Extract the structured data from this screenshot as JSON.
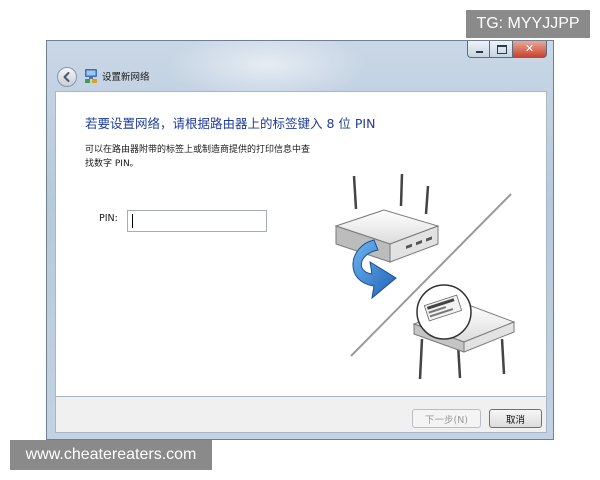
{
  "watermarks": {
    "top_right": "TG: MYYJJPP",
    "bottom_left": "www.cheatereaters.com"
  },
  "window": {
    "title": "设置新网络",
    "caption_buttons": [
      "minimize-icon",
      "maximize-icon",
      "close-icon"
    ],
    "back_icon": "back-arrow-icon",
    "title_icon": "network-icon"
  },
  "content": {
    "heading": "若要设置网络，请根据路由器上的标签键入 8 位 PIN",
    "instruction_line1": "可以在路由器附带的标签上或制造商提供的打印信息中查",
    "instruction_line2": "找数字 PIN。",
    "pin_label": "PIN:",
    "pin_value": "",
    "illustration": [
      "router-icon",
      "rotate-arrow-icon",
      "router-label-icon"
    ]
  },
  "footer": {
    "next_label": "下一步(N)",
    "cancel_label": "取消"
  },
  "colors": {
    "heading": "#1f3d9a",
    "frame": "#c3d2e2",
    "arrow": "#2f7fd0"
  }
}
